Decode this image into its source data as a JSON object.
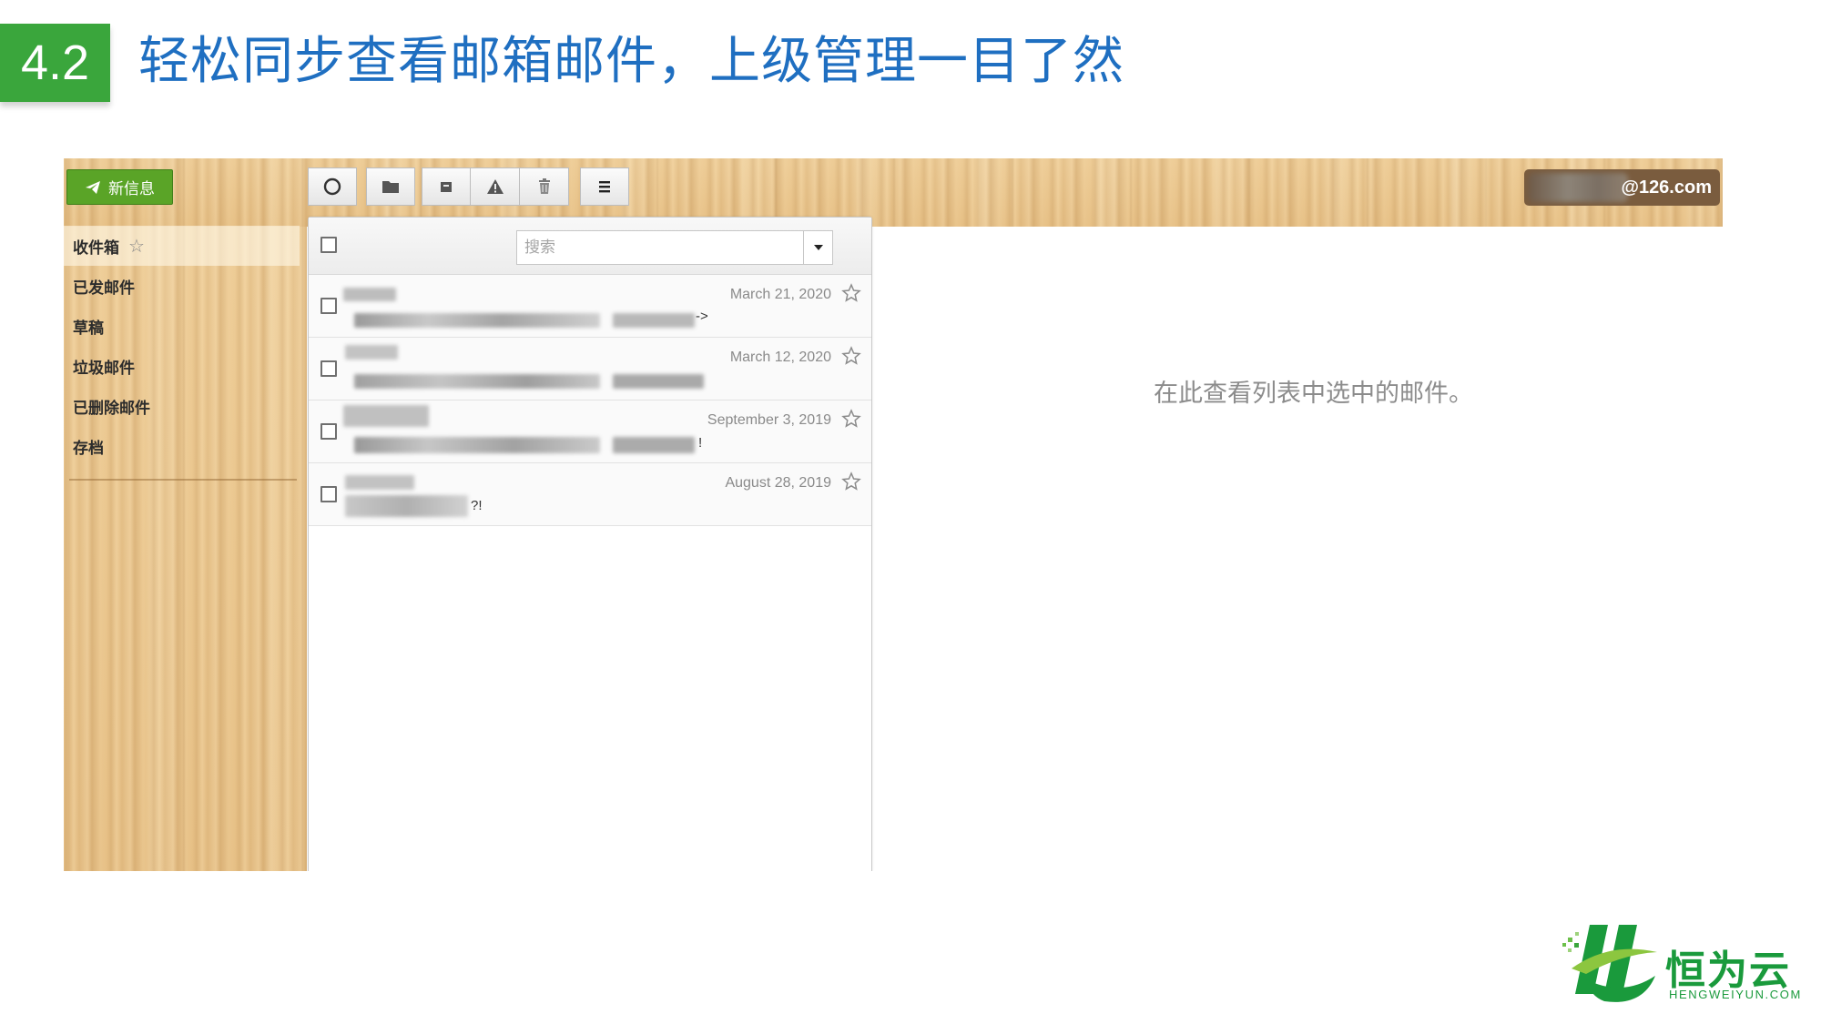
{
  "slide": {
    "section_number": "4.2",
    "title": "轻松同步查看邮箱邮件，上级管理一目了然"
  },
  "toolbar": {
    "compose_label": "新信息",
    "buttons": [
      "refresh-icon",
      "folder-icon",
      "archive-icon",
      "warning-icon",
      "trash-icon",
      "menu-icon"
    ],
    "account_suffix": "@126.com"
  },
  "sidebar": {
    "folders": [
      {
        "label": "收件箱",
        "active": true,
        "favorite_icon": "star-outline-icon"
      },
      {
        "label": "已发邮件"
      },
      {
        "label": "草稿"
      },
      {
        "label": "垃圾邮件"
      },
      {
        "label": "已删除邮件"
      },
      {
        "label": "存档"
      }
    ]
  },
  "message_list": {
    "search_placeholder": "搜索",
    "messages": [
      {
        "date": "March 21, 2020",
        "preview_tail": "->"
      },
      {
        "date": "March 12, 2020",
        "preview_tail": ""
      },
      {
        "date": "September 3, 2019",
        "preview_tail": "!"
      },
      {
        "date": "August 28, 2019",
        "preview_tail": "?!"
      }
    ]
  },
  "preview": {
    "empty_message": "在此查看列表中选中的邮件。"
  },
  "brand": {
    "name_cn": "恒为云",
    "name_en": "HENGWEIYUN.COM",
    "color": "#1a9a3c"
  },
  "colors": {
    "badge": "#3aa63c",
    "title": "#1f6fc1",
    "compose": "#5aa427"
  }
}
